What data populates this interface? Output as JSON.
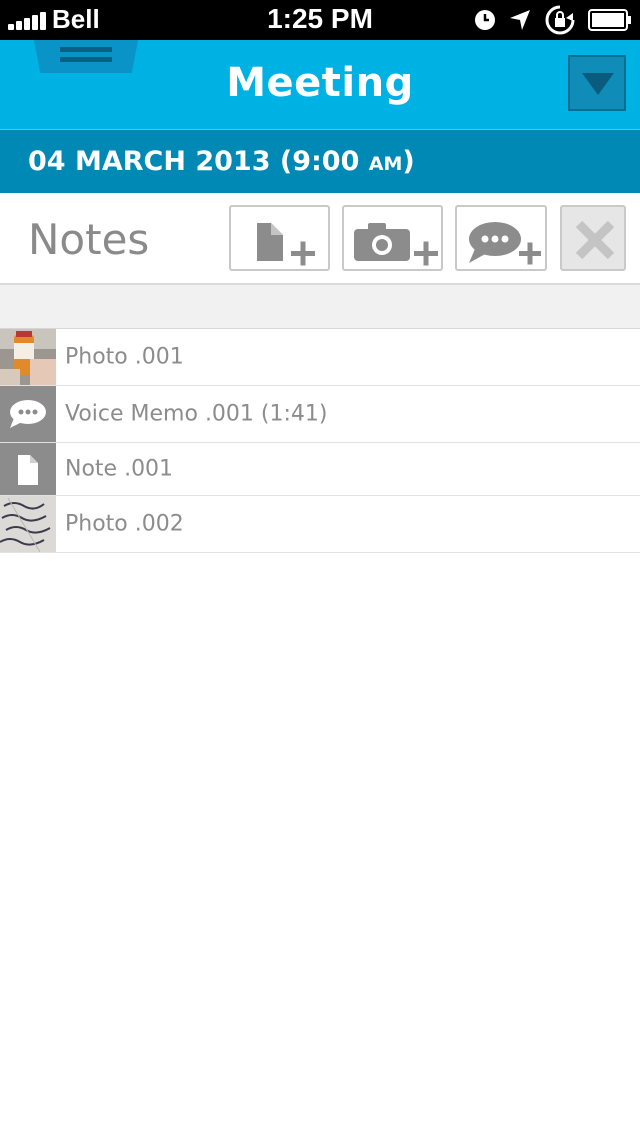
{
  "status_bar": {
    "carrier": "Bell",
    "time": "1:25 PM",
    "icons": [
      "signal-icon",
      "clock-icon",
      "location-arrow-icon",
      "rotation-lock-icon",
      "battery-icon"
    ]
  },
  "header": {
    "title": "Meeting",
    "menu_icon": "menu-icon",
    "dropdown_icon": "chevron-down-icon"
  },
  "date_bar": {
    "date": "04 MARCH 2013 (9:00 ",
    "ampm": "AM",
    "close": ")"
  },
  "notes_bar": {
    "title": "Notes",
    "buttons": [
      {
        "icon": "add-note-icon"
      },
      {
        "icon": "add-photo-icon"
      },
      {
        "icon": "add-voice-memo-icon"
      },
      {
        "icon": "delete-icon",
        "disabled": true
      }
    ]
  },
  "items": [
    {
      "label": "Photo .001",
      "type": "photo"
    },
    {
      "label": "Voice Memo .001 (1:41)",
      "type": "voice"
    },
    {
      "label": "Note .001",
      "type": "note"
    },
    {
      "label": "Photo .002",
      "type": "photo"
    }
  ],
  "colors": {
    "header_bg": "#00b1e4",
    "date_bar_bg": "#0089b4",
    "icon_gray": "#8c8c8c"
  }
}
